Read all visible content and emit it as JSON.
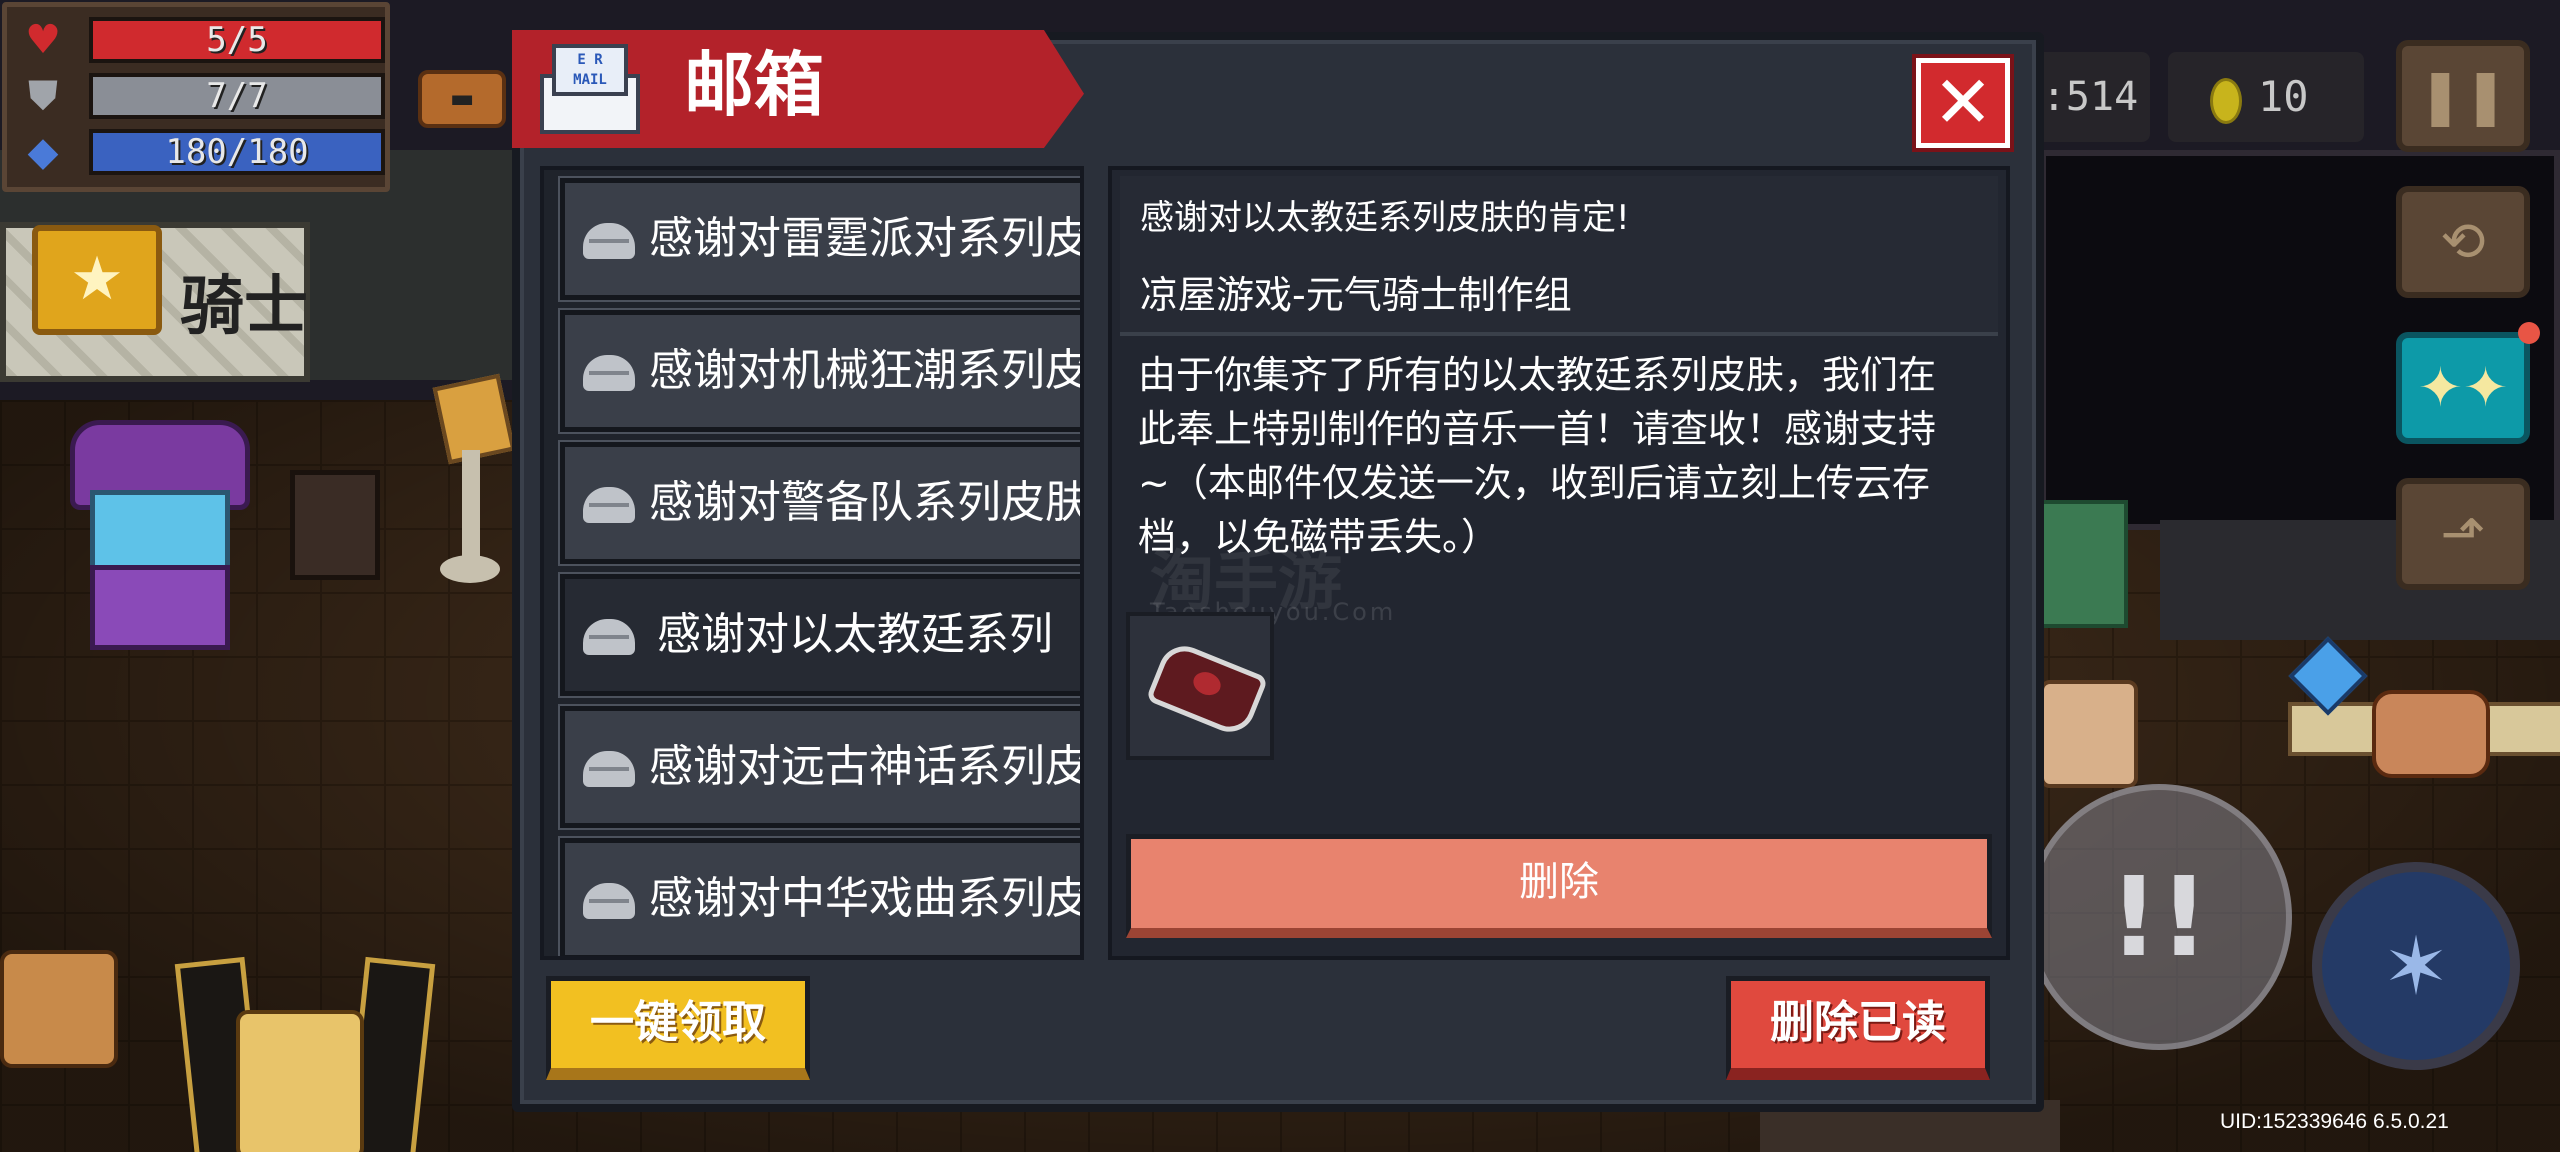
{
  "hud": {
    "health": "5/5",
    "armor": "7/7",
    "energy": "180/180",
    "gems": ":514",
    "coins": "10",
    "colors": {
      "health": "#d02a2e",
      "armor": "#a0a4aa",
      "energy": "#4a7ad8"
    }
  },
  "sign": {
    "text": "骑士"
  },
  "mailbox": {
    "title": "邮箱",
    "mail_icon_text": "E R\nMAIL",
    "close_label": "✕",
    "items": [
      {
        "label": "感谢对雷霆派对系列皮"
      },
      {
        "label": "感谢对机械狂潮系列皮"
      },
      {
        "label": "感谢对警备队系列皮肤"
      },
      {
        "label": "感谢对以太教廷系列"
      },
      {
        "label": "感谢对远古神话系列皮"
      },
      {
        "label": "感谢对中华戏曲系列皮"
      }
    ],
    "selected_index": 3,
    "detail": {
      "subject": "感谢对以太教廷系列皮肤的肯定!",
      "sender": "凉屋游戏-元气骑士制作组",
      "body": "由于你集齐了所有的以太教廷系列皮肤，我们在\n此奉上特别制作的音乐一首！请查收！感谢支持\n~（本邮件仅发送一次，收到后请立刻上传云存\n档，以免磁带丢失。）",
      "delete_label": "删除"
    },
    "claim_all_label": "一键领取",
    "delete_read_label": "删除已读"
  },
  "watermark": {
    "text": "淘手游",
    "sub": "Taoshouyou.Com"
  },
  "uid": "UID:152339646 6.5.0.21"
}
